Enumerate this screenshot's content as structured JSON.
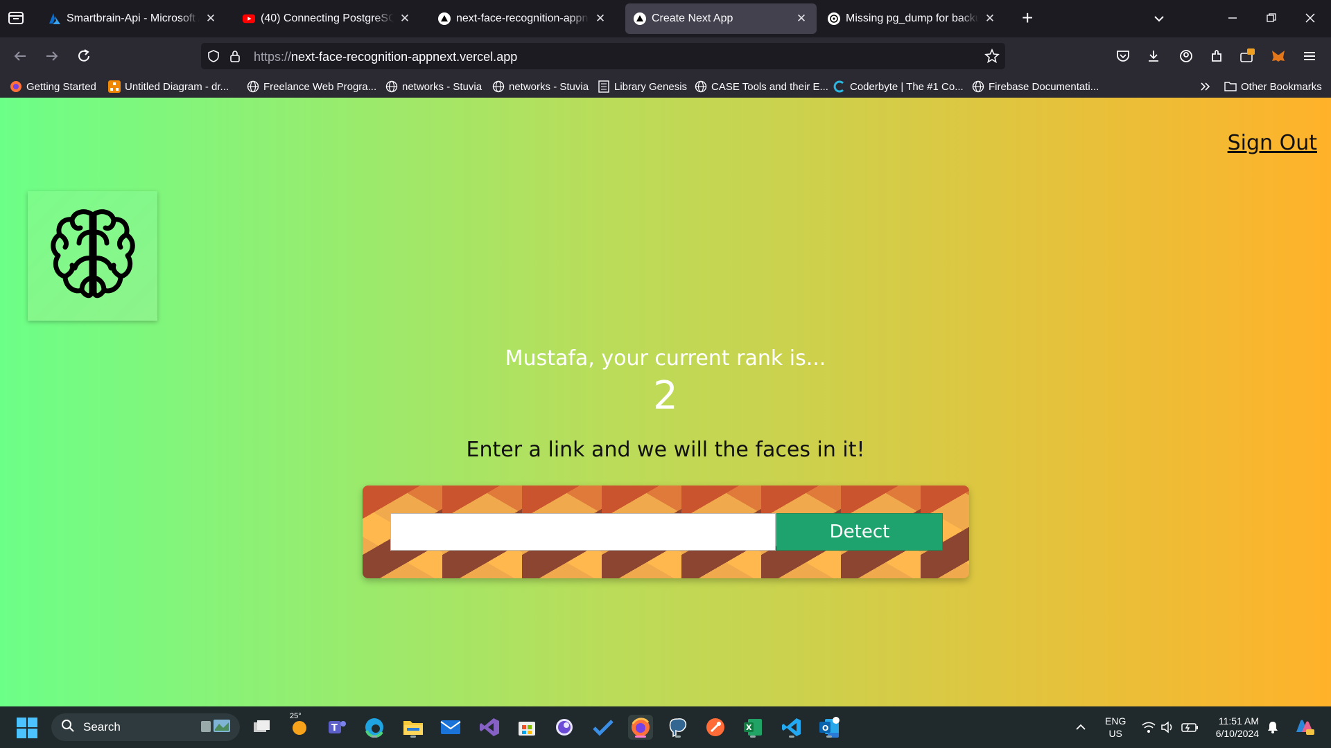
{
  "tabs": [
    {
      "title": "Smartbrain-Api - Microsoft Azure",
      "icon": "azure-icon"
    },
    {
      "title": "(40) Connecting PostgreSQL to Node",
      "icon": "youtube-icon"
    },
    {
      "title": "next-face-recognition-appnext",
      "icon": "vercel-icon"
    },
    {
      "title": "Create Next App",
      "icon": "vercel-icon",
      "active": true
    },
    {
      "title": "Missing pg_dump for backup",
      "icon": "chatgpt-icon"
    }
  ],
  "address": {
    "protocol": "https://",
    "host": "next-face-recognition-appnext.vercel.app"
  },
  "bookmarks": [
    {
      "label": "Getting Started",
      "icon": "firefox-icon"
    },
    {
      "label": "Untitled Diagram - dr...",
      "icon": "drawio-icon"
    },
    {
      "label": "Freelance Web Progra...",
      "icon": "globe-icon"
    },
    {
      "label": "networks - Stuvia",
      "icon": "globe-icon"
    },
    {
      "label": "networks - Stuvia",
      "icon": "globe-icon"
    },
    {
      "label": "Library Genesis",
      "icon": "book-icon"
    },
    {
      "label": "CASE Tools and their E...",
      "icon": "globe-icon"
    },
    {
      "label": "Coderbyte | The #1 Co...",
      "icon": "coderbyte-icon"
    },
    {
      "label": "Firebase Documentati...",
      "icon": "globe-icon"
    }
  ],
  "other_bookmarks": "Other Bookmarks",
  "page": {
    "sign_out": "Sign Out",
    "rank_text": "Mustafa, your current rank is...",
    "rank_value": "2",
    "instruction": "Enter a link and we will the faces in it!",
    "input_value": "",
    "detect_label": "Detect"
  },
  "taskbar": {
    "search_label": "Search",
    "weather_temp": "25°",
    "lang_top": "ENG",
    "lang_bottom": "US",
    "time": "11:51 AM",
    "date": "6/10/2024"
  },
  "colors": {
    "page_gradient_start": "#6cff88",
    "page_gradient_end": "#ffb22a",
    "detect_button": "#1ea36f",
    "active_tab": "#42414d"
  }
}
